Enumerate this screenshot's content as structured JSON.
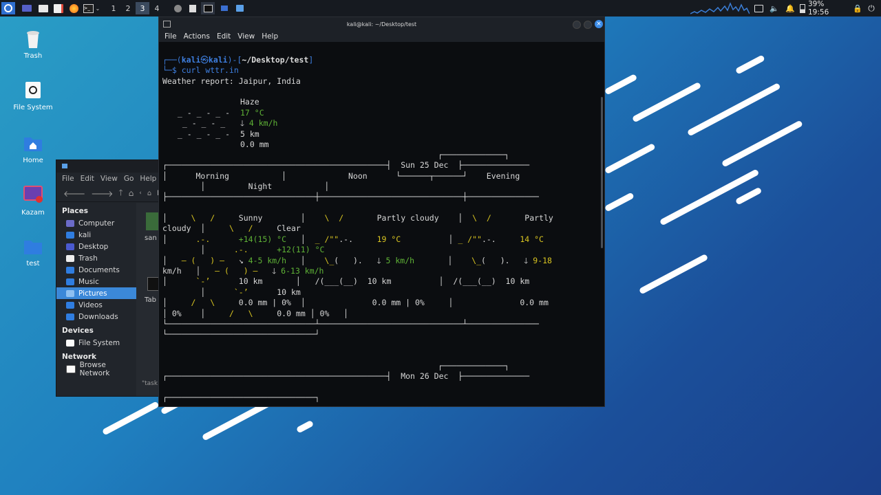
{
  "panel": {
    "workspaces": [
      "1",
      "2",
      "3",
      "4"
    ],
    "active_workspace": "3",
    "clock": "39% 19:56"
  },
  "desktop_icons": [
    {
      "label": "Trash"
    },
    {
      "label": "File System"
    },
    {
      "label": "Home"
    },
    {
      "label": "Kazam"
    },
    {
      "label": "test"
    }
  ],
  "file_manager": {
    "menu": [
      "File",
      "Edit",
      "View",
      "Go",
      "Help"
    ],
    "path": "kali",
    "sections": {
      "places": "Places",
      "devices": "Devices",
      "network": "Network"
    },
    "places": [
      "Computer",
      "kali",
      "Desktop",
      "Trash",
      "Documents",
      "Music",
      "Pictures",
      "Videos",
      "Downloads"
    ],
    "selected": "Pictures",
    "devices": [
      "File System"
    ],
    "network": [
      "Browse Network"
    ],
    "partial_1": "san",
    "partial_2": "Tab",
    "partial_3": "\"task"
  },
  "terminal": {
    "title": "kali@kali: ~/Desktop/test",
    "menu": [
      "File",
      "Actions",
      "Edit",
      "View",
      "Help"
    ],
    "prompt": {
      "user": "kali",
      "host": "kali",
      "path": "~/Desktop/test",
      "command": "curl wttr.in"
    },
    "lines": {
      "report": "Weather report: Jaipur, India",
      "cond": "Haze",
      "temp": "17 °C",
      "wind": "4 km/h",
      "vis": "5 km",
      "precip": "0.0 mm",
      "day1": "Sun 25 Dec",
      "day2": "Mon 26 Dec",
      "periods": [
        "Morning",
        "Noon",
        "Evening",
        "Night"
      ],
      "m_cond": "Sunny",
      "m_temp": "+14(15) °C",
      "m_wind": "4-5 km/h",
      "m_vis": "10 km",
      "m_prec": "0.0 mm | 0%",
      "n_cond": "Partly cloudy",
      "n_temp": "19 °C",
      "n_wind": "5 km/h",
      "n_vis": "10 km",
      "n_prec": "0.0 mm | 0%",
      "e_cond": "Partly",
      "e_cond2": "cloudy",
      "e_temp": "14 °C",
      "e_wind": "9-18",
      "e_wind2": "km/h",
      "e_vis": "10 km",
      "e_prec": "0.0 mm",
      "e_prec2": "0%",
      "ni_cond": "Clear",
      "ni_temp": "+12(11) °C",
      "ni_wind": "6-13 km/h",
      "ni_vis": "10 km",
      "ni_prec": "0.0 mm",
      "ni_prec2": "0%"
    }
  }
}
